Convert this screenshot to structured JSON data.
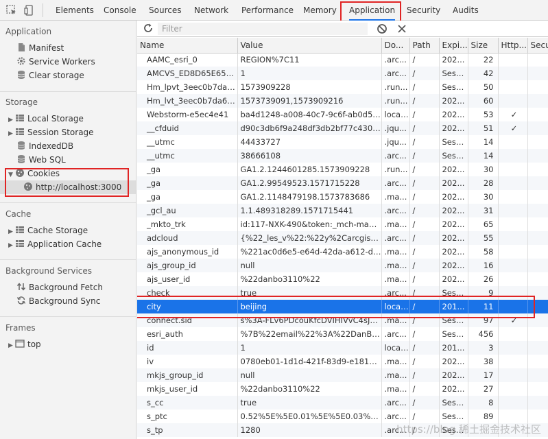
{
  "toolbar": {
    "tabs": [
      {
        "label": "Elements"
      },
      {
        "label": "Console"
      },
      {
        "label": "Sources"
      },
      {
        "label": "Network"
      },
      {
        "label": "Performance"
      },
      {
        "label": "Memory"
      },
      {
        "label": "Application"
      },
      {
        "label": "Security"
      },
      {
        "label": "Audits"
      }
    ],
    "active_tab": "Application",
    "accent": "#1a73e8"
  },
  "sidebar": {
    "application": {
      "title": "Application",
      "items": [
        {
          "label": "Manifest",
          "icon": "document-icon"
        },
        {
          "label": "Service Workers",
          "icon": "gear-icon"
        },
        {
          "label": "Clear storage",
          "icon": "database-icon"
        }
      ]
    },
    "storage": {
      "title": "Storage",
      "items": [
        {
          "label": "Local Storage",
          "icon": "grid-icon"
        },
        {
          "label": "Session Storage",
          "icon": "grid-icon"
        },
        {
          "label": "IndexedDB",
          "icon": "database-icon"
        },
        {
          "label": "Web SQL",
          "icon": "database-icon"
        },
        {
          "label": "Cookies",
          "icon": "cookie-icon"
        },
        {
          "label": "http://localhost:3000",
          "icon": "cookie-icon"
        }
      ]
    },
    "cache": {
      "title": "Cache",
      "items": [
        {
          "label": "Cache Storage",
          "icon": "grid-icon"
        },
        {
          "label": "Application Cache",
          "icon": "grid-icon"
        }
      ]
    },
    "background": {
      "title": "Background Services",
      "items": [
        {
          "label": "Background Fetch",
          "icon": "arrows-updown-icon"
        },
        {
          "label": "Background Sync",
          "icon": "sync-icon"
        }
      ]
    },
    "frames": {
      "title": "Frames",
      "items": [
        {
          "label": "top",
          "icon": "frame-icon"
        }
      ]
    }
  },
  "filter": {
    "placeholder": "Filter"
  },
  "table": {
    "columns": [
      "Name",
      "Value",
      "Do...",
      "Path",
      "Expi...",
      "Size",
      "Http...",
      "Secu"
    ],
    "rows": [
      [
        "AAMC_esri_0",
        "REGION%7C11",
        ".arc...",
        "/",
        "202...",
        "22",
        "",
        ""
      ],
      [
        "AMCVS_ED8D65E655F...",
        "1",
        ".arc...",
        "/",
        "Sess...",
        "42",
        "",
        ""
      ],
      [
        "Hm_lpvt_3eec0b7da6...",
        "1573909228",
        ".run...",
        "/",
        "Sess...",
        "50",
        "",
        ""
      ],
      [
        "Hm_lvt_3eec0b7da654...",
        "1573739091,1573909216",
        ".run...",
        "/",
        "202...",
        "60",
        "",
        ""
      ],
      [
        "Webstorm-e5ec4e41",
        "ba4d1248-a008-40c7-9c6f-ab0d52...",
        "local...",
        "/",
        "202...",
        "53",
        "✓",
        ""
      ],
      [
        "__cfduid",
        "d90c3db6f9a248df3db2bf77c4301c...",
        ".jqu...",
        "/",
        "202...",
        "51",
        "✓",
        ""
      ],
      [
        "__utmc",
        "44433727",
        ".jqu...",
        "/",
        "Sess...",
        "14",
        "",
        ""
      ],
      [
        "__utmc",
        "38666108",
        ".arc...",
        "/",
        "Sess...",
        "14",
        "",
        ""
      ],
      [
        "_ga",
        "GA1.2.1244601285.1573909228",
        ".run...",
        "/",
        "202...",
        "30",
        "",
        ""
      ],
      [
        "_ga",
        "GA1.2.99549523.1571715228",
        ".arc...",
        "/",
        "202...",
        "28",
        "",
        ""
      ],
      [
        "_ga",
        "GA1.2.1148479198.1573783686",
        ".ma...",
        "/",
        "202...",
        "30",
        "",
        ""
      ],
      [
        "_gcl_au",
        "1.1.489318289.1571715441",
        ".arc...",
        "/",
        "202...",
        "31",
        "",
        ""
      ],
      [
        "_mkto_trk",
        "id:117-NXK-490&token:_mch-mapb...",
        ".ma...",
        "/",
        "202...",
        "65",
        "",
        ""
      ],
      [
        "adcloud",
        "{%22_les_v%22:%22y%2Carcgis.co...",
        ".arc...",
        "/",
        "202...",
        "55",
        "",
        ""
      ],
      [
        "ajs_anonymous_id",
        "%221ac0d6e5-e64d-42da-a612-dc4...",
        ".ma...",
        "/",
        "202...",
        "58",
        "",
        ""
      ],
      [
        "ajs_group_id",
        "null",
        ".ma...",
        "/",
        "202...",
        "16",
        "",
        ""
      ],
      [
        "ajs_user_id",
        "%22danbo3110%22",
        ".ma...",
        "/",
        "202...",
        "26",
        "",
        ""
      ],
      [
        "check",
        "true",
        ".arc...",
        "/",
        "Sess...",
        "9",
        "",
        ""
      ],
      [
        "city",
        "beijing",
        "local...",
        "/",
        "201...",
        "11",
        "",
        ""
      ],
      [
        "connect.sid",
        "s%3A-FLv6PDcouKfcDVIHIVvC4sJUB...",
        ".ma...",
        "/",
        "Sess...",
        "97",
        "✓",
        ""
      ],
      [
        "esri_auth",
        "%7B%22email%22%3A%22DanBo3...",
        ".arc...",
        "/",
        "Sess...",
        "456",
        "",
        ""
      ],
      [
        "id",
        "1",
        "local...",
        "/",
        "201...",
        "3",
        "",
        ""
      ],
      [
        "iv",
        "0780eb01-1d1d-421f-83d9-e18182...",
        ".ma...",
        "/",
        "202...",
        "38",
        "",
        ""
      ],
      [
        "mkjs_group_id",
        "null",
        ".ma...",
        "/",
        "202...",
        "17",
        "",
        ""
      ],
      [
        "mkjs_user_id",
        "%22danbo3110%22",
        ".ma...",
        "/",
        "202...",
        "27",
        "",
        ""
      ],
      [
        "s_cc",
        "true",
        ".arc...",
        "/",
        "Sess...",
        "8",
        "",
        ""
      ],
      [
        "s_ptc",
        "0.52%5E%5E0.01%5E%5E0.03%5E%...",
        ".arc...",
        "/",
        "Sess...",
        "89",
        "",
        ""
      ],
      [
        "s_tp",
        "1280",
        ".arc...",
        "/",
        "Sess...",
        "",
        "",
        ""
      ]
    ],
    "selected_row_name": "city",
    "selected_color": "#1a73e8"
  },
  "watermark": "https://blog.稀土掘金技术社区",
  "highlight_color": "#e02424"
}
